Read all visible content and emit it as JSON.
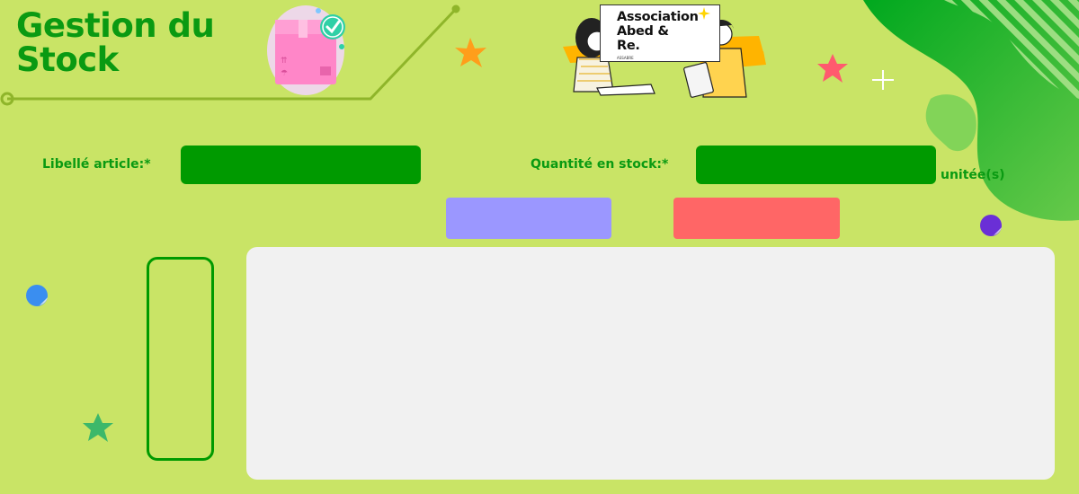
{
  "header": {
    "title": "Gestion du\nStock",
    "logo": {
      "text": "Association\nAbed &\nRe.",
      "tagline": "ASSABRE"
    }
  },
  "form": {
    "libelle_label": "Libellé article:*",
    "libelle_value": "",
    "quantite_label": "Quantité en stock:*",
    "quantite_value": "",
    "unit_label": "unitée(s)"
  },
  "buttons": {
    "add_label": "",
    "delete_label": ""
  },
  "colors": {
    "background": "#c9e466",
    "accent_green": "#009a00",
    "title_green": "#0a9a12",
    "add_button": "#9b97ff",
    "delete_button": "#ff6666",
    "panel": "#f1f1f1"
  },
  "icons": [
    "box-icon",
    "check-icon",
    "star-icon",
    "plus-icon",
    "dot-icon"
  ]
}
